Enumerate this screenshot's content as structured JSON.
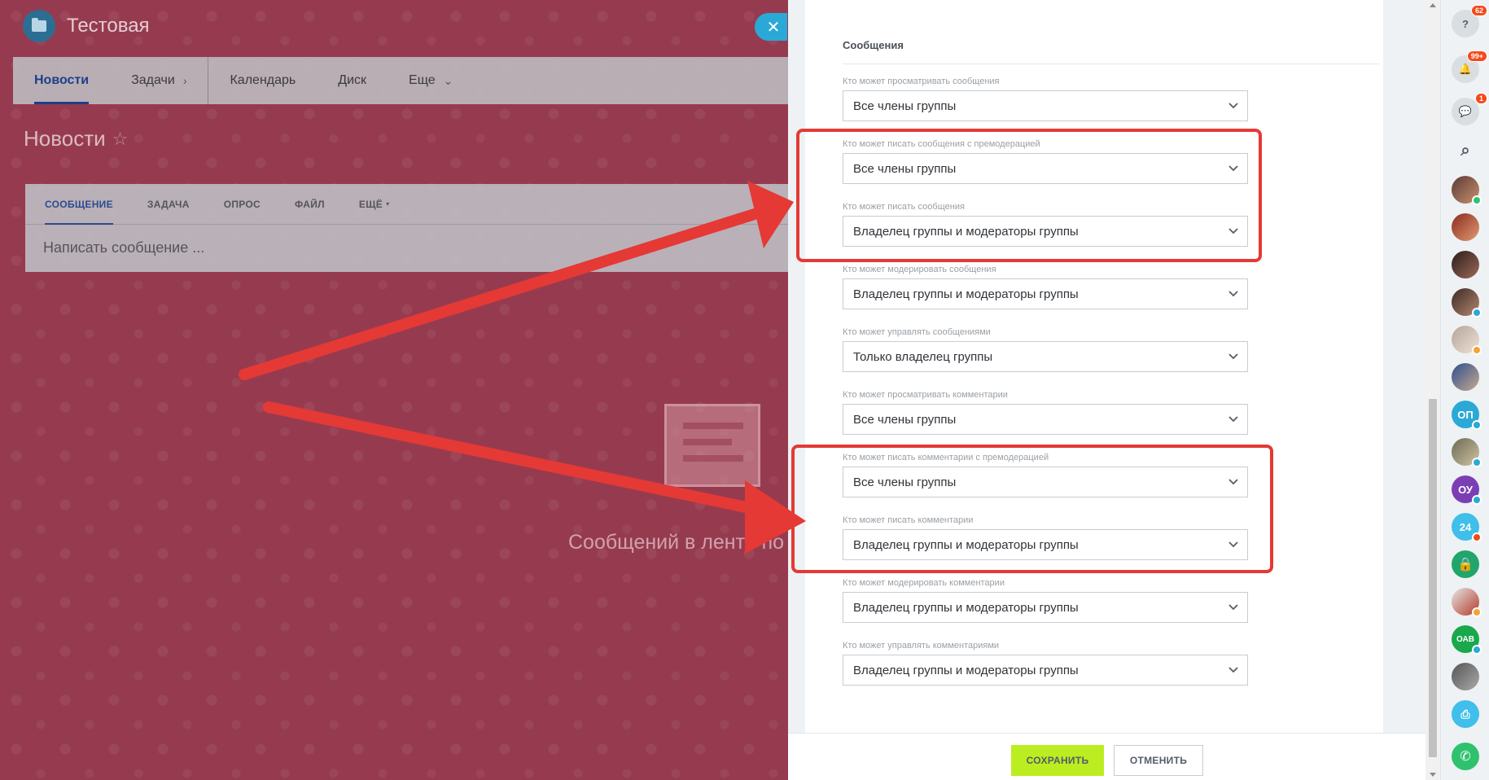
{
  "group": {
    "name": "Тестовая"
  },
  "topnav": {
    "items": [
      {
        "label": "Новости",
        "active": true
      },
      {
        "label": "Задачи"
      },
      {
        "label": "Календарь"
      },
      {
        "label": "Диск"
      },
      {
        "label": "Еще"
      }
    ]
  },
  "page": {
    "heading": "Новости"
  },
  "feed": {
    "tabs": [
      "СООБЩЕНИЕ",
      "ЗАДАЧА",
      "ОПРОС",
      "ФАЙЛ",
      "ЕЩЁ"
    ],
    "placeholder": "Написать сообщение ...",
    "empty_text": "Сообщений в ленте по"
  },
  "panel": {
    "section_title": "Сообщения",
    "fields": [
      {
        "label": "Кто может просматривать сообщения",
        "value": "Все члены группы"
      },
      {
        "label": "Кто может писать сообщения с премодерацией",
        "value": "Все члены группы"
      },
      {
        "label": "Кто может писать сообщения",
        "value": "Владелец группы и модераторы группы"
      },
      {
        "label": "Кто может модерировать сообщения",
        "value": "Владелец группы и модераторы группы"
      },
      {
        "label": "Кто может управлять сообщениями",
        "value": "Только владелец группы"
      },
      {
        "label": "Кто может просматривать комментарии",
        "value": "Все члены группы"
      },
      {
        "label": "Кто может писать комментарии с премодерацией",
        "value": "Все члены группы"
      },
      {
        "label": "Кто может писать комментарии",
        "value": "Владелец группы и модераторы группы"
      },
      {
        "label": "Кто может модерировать комментарии",
        "value": "Владелец группы и модераторы группы"
      },
      {
        "label": "Кто может управлять комментариями",
        "value": "Владелец группы и модераторы группы"
      }
    ],
    "save_label": "СОХРАНИТЬ",
    "cancel_label": "ОТМЕНИТЬ"
  },
  "rightbar": {
    "help_badge": "62",
    "notifications_badge": "99+",
    "chat_badge": "1",
    "initials": [
      "ОП",
      "ОУ",
      "ОАВ"
    ]
  },
  "colors": {
    "highlight": "#e53935",
    "save_button": "#bbed21",
    "accent": "#2aa9d6"
  }
}
